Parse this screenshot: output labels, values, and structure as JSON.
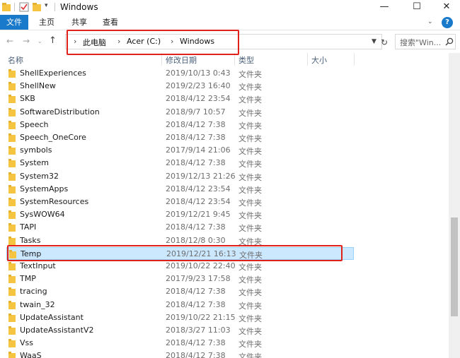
{
  "window": {
    "title": "Windows",
    "controls": {
      "minimize": "—",
      "maximize": "☐",
      "close": "✕"
    }
  },
  "ribbon": {
    "tabs": [
      "文件",
      "主页",
      "共享",
      "查看"
    ],
    "help": "?"
  },
  "nav": {
    "back": "←",
    "forward": "→",
    "recent": "⌄",
    "up": "↑",
    "refresh": "↻",
    "breadcrumb": [
      "此电脑",
      "Acer (C:)",
      "Windows"
    ],
    "search_placeholder": "搜索\"Win..."
  },
  "columns": [
    "名称",
    "修改日期",
    "类型",
    "大小"
  ],
  "rows": [
    {
      "name": "ShellExperiences",
      "date": "2019/10/13 0:43",
      "type": "文件夹"
    },
    {
      "name": "ShellNew",
      "date": "2019/2/23 16:40",
      "type": "文件夹"
    },
    {
      "name": "SKB",
      "date": "2018/4/12 23:54",
      "type": "文件夹"
    },
    {
      "name": "SoftwareDistribution",
      "date": "2018/9/7 10:57",
      "type": "文件夹"
    },
    {
      "name": "Speech",
      "date": "2018/4/12 7:38",
      "type": "文件夹"
    },
    {
      "name": "Speech_OneCore",
      "date": "2018/4/12 7:38",
      "type": "文件夹"
    },
    {
      "name": "symbols",
      "date": "2017/9/14 21:06",
      "type": "文件夹"
    },
    {
      "name": "System",
      "date": "2018/4/12 7:38",
      "type": "文件夹"
    },
    {
      "name": "System32",
      "date": "2019/12/13 21:26",
      "type": "文件夹"
    },
    {
      "name": "SystemApps",
      "date": "2018/4/12 23:54",
      "type": "文件夹"
    },
    {
      "name": "SystemResources",
      "date": "2018/4/12 23:54",
      "type": "文件夹"
    },
    {
      "name": "SysWOW64",
      "date": "2019/12/21 9:45",
      "type": "文件夹"
    },
    {
      "name": "TAPI",
      "date": "2018/4/12 7:38",
      "type": "文件夹"
    },
    {
      "name": "Tasks",
      "date": "2018/12/8 0:30",
      "type": "文件夹"
    },
    {
      "name": "Temp",
      "date": "2019/12/21 16:13",
      "type": "文件夹"
    },
    {
      "name": "TextInput",
      "date": "2019/10/22 22:40",
      "type": "文件夹"
    },
    {
      "name": "TMP",
      "date": "2017/9/23 17:58",
      "type": "文件夹"
    },
    {
      "name": "tracing",
      "date": "2018/4/12 7:38",
      "type": "文件夹"
    },
    {
      "name": "twain_32",
      "date": "2018/4/12 7:38",
      "type": "文件夹"
    },
    {
      "name": "UpdateAssistant",
      "date": "2019/10/22 21:15",
      "type": "文件夹"
    },
    {
      "name": "UpdateAssistantV2",
      "date": "2018/3/27 11:03",
      "type": "文件夹"
    },
    {
      "name": "Vss",
      "date": "2018/4/12 7:38",
      "type": "文件夹"
    },
    {
      "name": "WaaS",
      "date": "2018/4/12 7:38",
      "type": "文件夹"
    }
  ],
  "selected_index": 14,
  "colors": {
    "accent": "#1979ca",
    "selection": "#cce8ff",
    "highlight_box": "#e0211a",
    "folder": "#f5c542"
  }
}
